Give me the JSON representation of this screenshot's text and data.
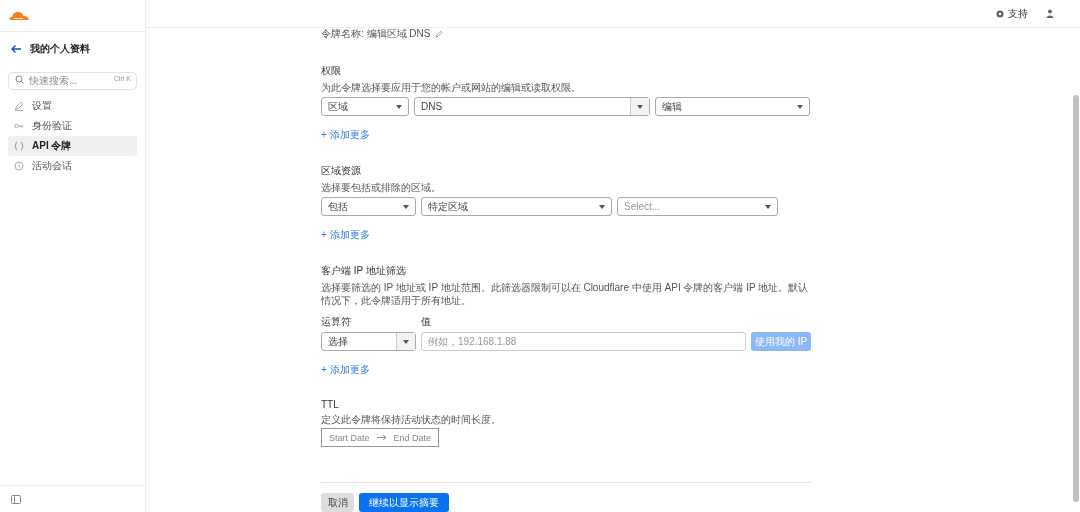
{
  "sidebar": {
    "title": "我的个人资料",
    "search": {
      "placeholder": "快速搜索...",
      "shortcut": "Ctrl K"
    },
    "items": [
      {
        "label": "设置",
        "selected": false
      },
      {
        "label": "身份验证",
        "selected": false
      },
      {
        "label": "API 令牌",
        "selected": true
      },
      {
        "label": "活动会话",
        "selected": false
      }
    ]
  },
  "header": {
    "support": "支持"
  },
  "token_name": "令牌名称: 编辑区域 DNS",
  "sections": [
    {
      "kind": "selects",
      "title": "权限",
      "description": "为此令牌选择要应用于您的帐户或网站的编辑或读取权限。",
      "selects": [
        {
          "value": "区域",
          "split": false
        },
        {
          "value": "DNS",
          "split": true
        },
        {
          "value": "编辑",
          "split": false
        }
      ],
      "add_more": "+ 添加更多"
    },
    {
      "kind": "selects",
      "title": "区域资源",
      "description": "选择要包括或排除的区域。",
      "selects": [
        {
          "value": "包括",
          "split": false
        },
        {
          "value": "特定区域",
          "split": false
        },
        {
          "placeholder": "Select...",
          "split": false
        }
      ],
      "add_more": "+ 添加更多"
    },
    {
      "kind": "ip",
      "title": "客户端 IP 地址筛选",
      "description": "选择要筛选的 IP 地址或 IP 地址范围。此筛选器限制可以在 Cloudflare 中使用 API 令牌的客户端 IP 地址。默认情况下，此令牌适用于所有地址。",
      "operator_label": "运算符",
      "value_label": "值",
      "operator": {
        "value": "选择",
        "split": true
      },
      "value_placeholder": "例如，192.168.1.88",
      "button": {
        "label": "使用我的 IP",
        "disabled": true
      },
      "add_more": "+ 添加更多"
    },
    {
      "kind": "ttl",
      "title": "TTL",
      "description": "定义此令牌将保持活动状态的时间长度。",
      "start_placeholder": "Start Date",
      "end_placeholder": "End Date"
    }
  ],
  "buttons": [
    {
      "label": "取消",
      "kind": "secondary"
    },
    {
      "label": "继续以显示摘要",
      "kind": "primary"
    }
  ]
}
